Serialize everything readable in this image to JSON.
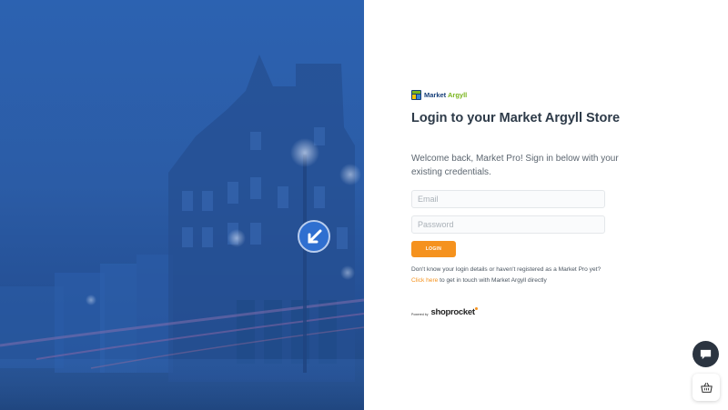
{
  "brand": {
    "name_part1": "Market",
    "name_part2": "Argyll",
    "logo_icon": "market-argyll-logo-icon"
  },
  "login": {
    "title": "Login to your Market Argyll Store",
    "subtitle": "Welcome back, Market Pro! Sign in below with your existing credentials.",
    "email_placeholder": "Email",
    "password_placeholder": "Password",
    "login_label": "LOGIN",
    "help_prefix": "Don't know your login details or haven't registered as a Market Pro yet?",
    "help_link": "Click here",
    "help_suffix": "to get in touch with Market Argyll directly"
  },
  "footer": {
    "powered_by": "Powered by",
    "provider": "shoprocket"
  },
  "widgets": {
    "chat_icon": "chat-bubble-icon",
    "cart_icon": "basket-icon"
  },
  "colors": {
    "accent": "#f5921e",
    "hero_blue": "#2b5ca6",
    "title": "#2d3a48",
    "brand_navy": "#173f7a",
    "brand_green": "#7ab51d"
  }
}
